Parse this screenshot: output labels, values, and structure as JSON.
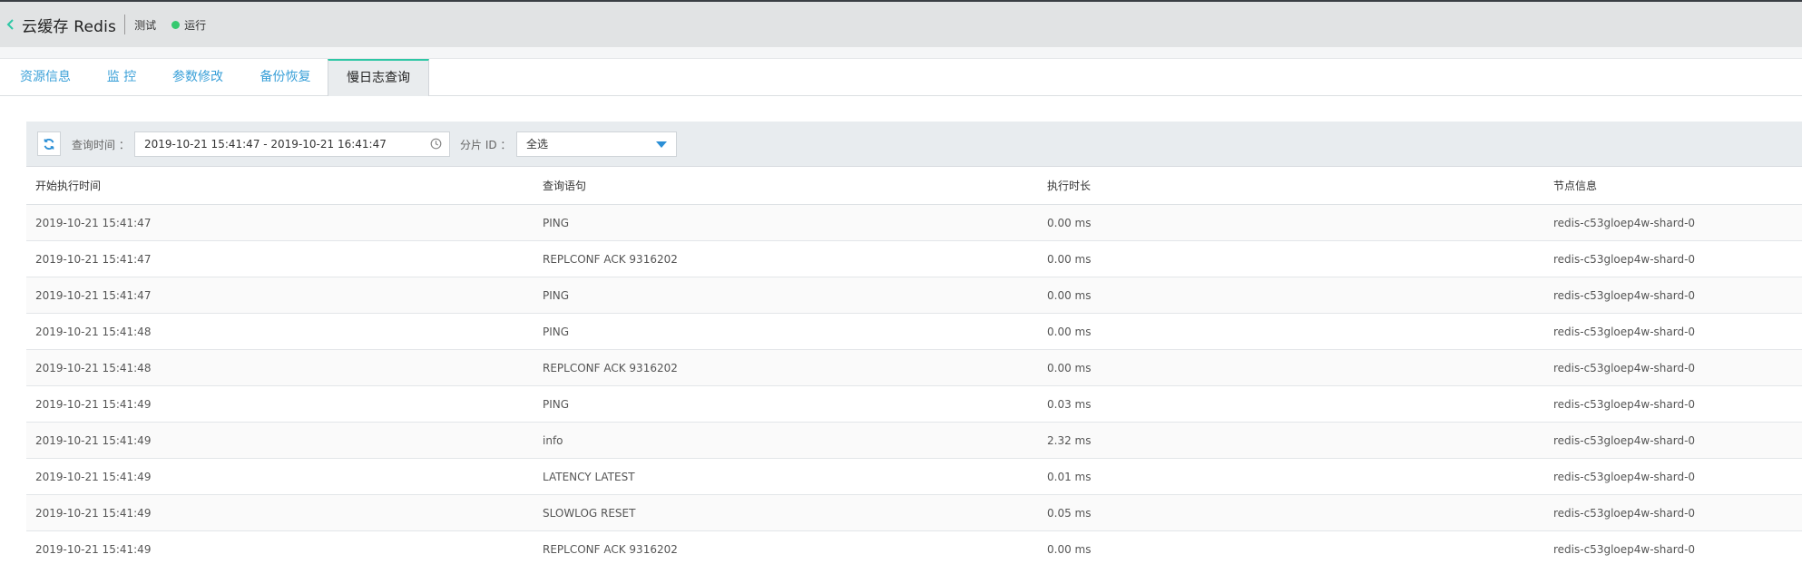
{
  "header": {
    "title": "云缓存 Redis",
    "env": "测试",
    "status": "运行",
    "status_color": "#36c96f",
    "accent_color": "#2ec7a5"
  },
  "tabs": [
    {
      "label": "资源信息",
      "active": false
    },
    {
      "label": "监 控",
      "active": false
    },
    {
      "label": "参数修改",
      "active": false
    },
    {
      "label": "备份恢复",
      "active": false
    },
    {
      "label": "慢日志查询",
      "active": true
    }
  ],
  "filter": {
    "query_time_label": "查询时间 ：",
    "date_range": "2019-10-21 15:41:47 - 2019-10-21 16:41:47",
    "shard_label": "分片 ID ：",
    "shard_value": "全选",
    "refresh_icon": "refresh-icon",
    "clock_icon": "clock-icon"
  },
  "table": {
    "columns": [
      "开始执行时间",
      "查询语句",
      "执行时长",
      "节点信息"
    ],
    "rows": [
      [
        "2019-10-21 15:41:47",
        "PING",
        "0.00 ms",
        "redis-c53gloep4w-shard-0"
      ],
      [
        "2019-10-21 15:41:47",
        "REPLCONF ACK 9316202",
        "0.00 ms",
        "redis-c53gloep4w-shard-0"
      ],
      [
        "2019-10-21 15:41:47",
        "PING",
        "0.00 ms",
        "redis-c53gloep4w-shard-0"
      ],
      [
        "2019-10-21 15:41:48",
        "PING",
        "0.00 ms",
        "redis-c53gloep4w-shard-0"
      ],
      [
        "2019-10-21 15:41:48",
        "REPLCONF ACK 9316202",
        "0.00 ms",
        "redis-c53gloep4w-shard-0"
      ],
      [
        "2019-10-21 15:41:49",
        "PING",
        "0.03 ms",
        "redis-c53gloep4w-shard-0"
      ],
      [
        "2019-10-21 15:41:49",
        "info",
        "2.32 ms",
        "redis-c53gloep4w-shard-0"
      ],
      [
        "2019-10-21 15:41:49",
        "LATENCY LATEST",
        "0.01 ms",
        "redis-c53gloep4w-shard-0"
      ],
      [
        "2019-10-21 15:41:49",
        "SLOWLOG RESET",
        "0.05 ms",
        "redis-c53gloep4w-shard-0"
      ],
      [
        "2019-10-21 15:41:49",
        "REPLCONF ACK 9316202",
        "0.00 ms",
        "redis-c53gloep4w-shard-0"
      ]
    ]
  }
}
